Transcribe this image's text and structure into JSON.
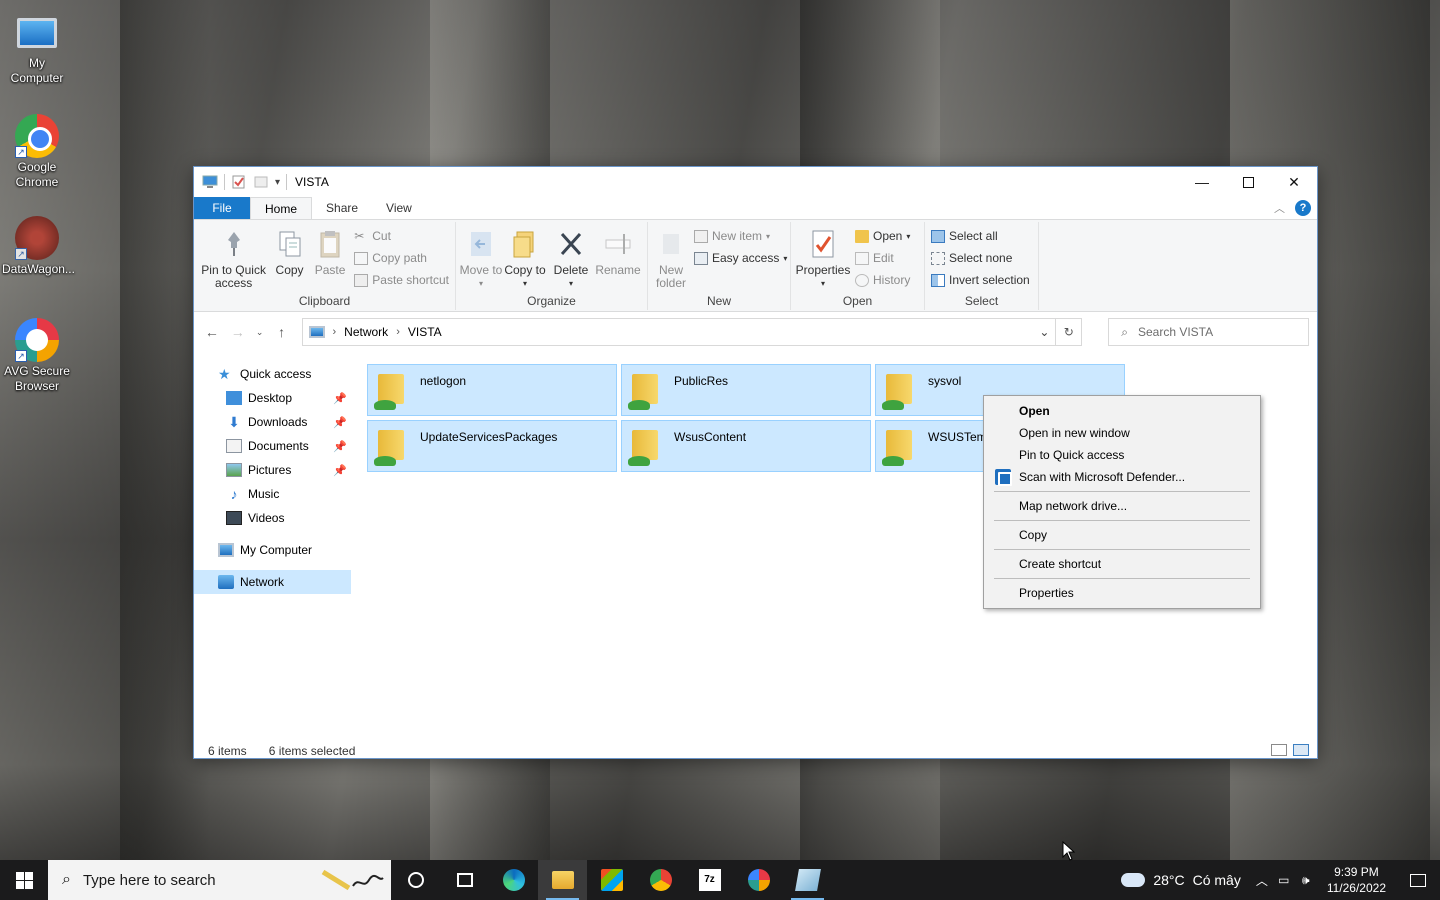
{
  "desktop": {
    "icons": [
      {
        "label": "My Computer"
      },
      {
        "label": "Google Chrome"
      },
      {
        "label": "DataWagon..."
      },
      {
        "label": "AVG Secure Browser"
      }
    ]
  },
  "window": {
    "title": "VISTA",
    "ribbon_tabs": [
      "File",
      "Home",
      "Share",
      "View"
    ],
    "active_tab": "Home",
    "ribbon": {
      "clipboard": {
        "label": "Clipboard",
        "pin": "Pin to Quick access",
        "copy": "Copy",
        "paste": "Paste",
        "cut": "Cut",
        "copy_path": "Copy path",
        "paste_shortcut": "Paste shortcut"
      },
      "organize": {
        "label": "Organize",
        "move_to": "Move to",
        "copy_to": "Copy to",
        "delete": "Delete",
        "rename": "Rename"
      },
      "new": {
        "label": "New",
        "new_folder": "New folder",
        "new_item": "New item",
        "easy_access": "Easy access"
      },
      "open": {
        "label": "Open",
        "properties": "Properties",
        "open": "Open",
        "edit": "Edit",
        "history": "History"
      },
      "select": {
        "label": "Select",
        "select_all": "Select all",
        "select_none": "Select none",
        "invert": "Invert selection"
      }
    },
    "address": {
      "crumbs": [
        "Network",
        "VISTA"
      ],
      "search_placeholder": "Search VISTA"
    },
    "nav": {
      "quick_access": "Quick access",
      "pinned": [
        "Desktop",
        "Downloads",
        "Documents",
        "Pictures"
      ],
      "other": [
        "Music",
        "Videos"
      ],
      "my_computer": "My Computer",
      "network": "Network"
    },
    "items": [
      "netlogon",
      "PublicRes",
      "sysvol",
      "UpdateServicesPackages",
      "WsusContent",
      "WSUSTem"
    ],
    "status": {
      "count": "6 items",
      "selected": "6 items selected"
    }
  },
  "context_menu": {
    "items": [
      {
        "label": "Open",
        "bold": true
      },
      {
        "label": "Open in new window"
      },
      {
        "label": "Pin to Quick access"
      },
      {
        "label": "Scan with Microsoft Defender..."
      },
      {
        "label": "Map network drive..."
      },
      {
        "label": "Copy"
      },
      {
        "label": "Create shortcut"
      },
      {
        "label": "Properties"
      }
    ]
  },
  "taskbar": {
    "search_placeholder": "Type here to search",
    "weather": "28°C",
    "weather_desc": "Có mây",
    "time": "9:39 PM",
    "date": "11/26/2022"
  },
  "colors": {
    "accent": "#1979ca",
    "selection": "#cce8ff",
    "taskbar": "#1b1b1c"
  }
}
